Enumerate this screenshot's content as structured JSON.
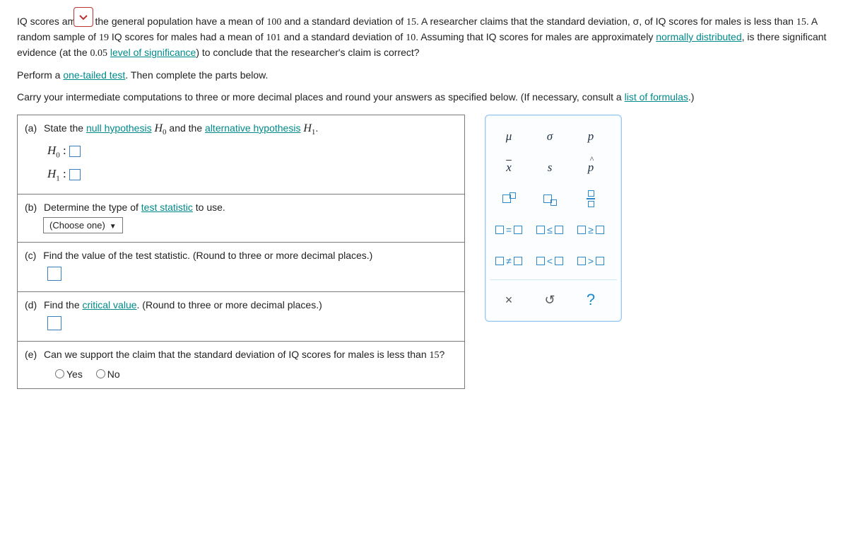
{
  "intro": {
    "p1_a": "IQ scores among the general population have a mean of ",
    "v_mean": "100",
    "p1_b": " and a standard deviation of ",
    "v_sd": "15",
    "p1_c": ". A researcher claims that the standard deviation, σ, of IQ scores for males is less than ",
    "v_sd2": "15",
    "p1_d": ". A random sample of ",
    "v_n": "19",
    "p1_e": " IQ scores for males had a mean of ",
    "v_smean": "101",
    "p1_f": " and a standard deviation of ",
    "v_ssd": "10",
    "p1_g": ". Assuming that IQ scores for males are approximately ",
    "link_normal": "normally distributed",
    "p1_h": ", is there significant evidence (at the ",
    "v_alpha": "0.05",
    "space": " ",
    "link_sig": "level of significance",
    "p1_i": ") to conclude that the researcher's claim is correct?",
    "p2_a": "Perform a ",
    "link_tail": "one-tailed test",
    "p2_b": ". Then complete the parts below.",
    "p3_a": "Carry your intermediate computations to three or more decimal places and round your answers as specified below. (If necessary, consult a ",
    "link_formulas": "list of formulas",
    "p3_b": ".)"
  },
  "parts": {
    "a": {
      "label": "(a)",
      "text_a": "State the ",
      "link_null": "null hypothesis",
      "text_b": " ",
      "h0": "H",
      "sub0": "0",
      "text_c": " and the ",
      "link_alt": "alternative hypothesis",
      "text_d": " ",
      "h1": "H",
      "sub1": "1",
      "text_e": ".",
      "row0_sym": "H",
      "row0_sub": "0",
      "row0_colon": " : ",
      "row1_sym": "H",
      "row1_sub": "1",
      "row1_colon": " : "
    },
    "b": {
      "label": "(b)",
      "text_a": "Determine the type of ",
      "link_ts": "test statistic",
      "text_b": " to use.",
      "select": "(Choose one)"
    },
    "c": {
      "label": "(c)",
      "text": "Find the value of the test statistic. (Round to three or more decimal places.)"
    },
    "d": {
      "label": "(d)",
      "text_a": "Find the ",
      "link_cv": "critical value",
      "text_b": ". (Round to three or more decimal places.)"
    },
    "e": {
      "label": "(e)",
      "text_a": "Can we support the claim that the standard deviation of IQ scores for males is less than ",
      "v": "15",
      "text_b": "?",
      "yes": "Yes",
      "no": "No"
    }
  },
  "palette": {
    "mu": "μ",
    "sigma": "σ",
    "p": "p",
    "xbar": "x",
    "s": "s",
    "phat": "p",
    "eq": "=",
    "le": "≤",
    "ge": "≥",
    "ne": "≠",
    "lt": "<",
    "gt": ">",
    "clear": "×",
    "undo": "↺",
    "help": "?"
  }
}
